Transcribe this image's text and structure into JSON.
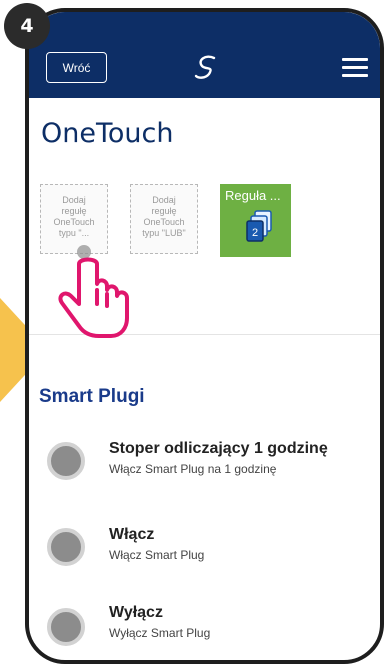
{
  "step": {
    "number": "4"
  },
  "colors": {
    "topbar": "#0d2e66",
    "accent": "#1a3b8a",
    "green_tile": "#6eb043",
    "pointer": "#f6c24d",
    "hand": "#e0166d"
  },
  "header": {
    "back_label": "Wróć",
    "logo_icon": "salus-logo-icon",
    "menu_icon": "hamburger-menu-icon"
  },
  "page": {
    "title": "OneTouch"
  },
  "rules": [
    {
      "lines": [
        "Dodaj",
        "regułę",
        "OneTouch",
        "typu \"..."
      ]
    },
    {
      "lines": [
        "Dodaj",
        "regułę",
        "OneTouch",
        "typu \"LUB\""
      ]
    }
  ],
  "rule_tile": {
    "label": "Reguła ...",
    "badge": "2",
    "icon": "stacked-cards-icon"
  },
  "section": {
    "title": "Smart Plugi"
  },
  "items": [
    {
      "title": "Stoper odliczający 1 godzinę",
      "subtitle": "Włącz Smart Plug na 1 godzinę"
    },
    {
      "title": "Włącz",
      "subtitle": "Włącz Smart Plug"
    },
    {
      "title": "Wyłącz",
      "subtitle": "Wyłącz Smart Plug"
    }
  ]
}
